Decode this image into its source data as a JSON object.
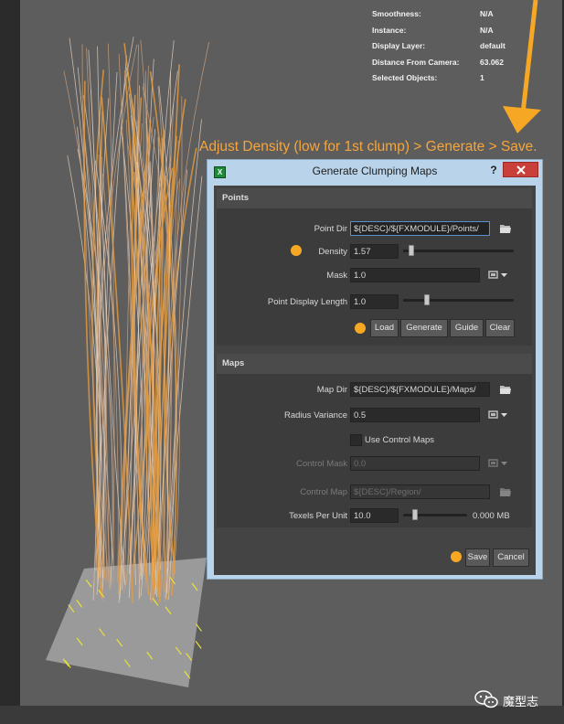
{
  "hud": {
    "rows": [
      {
        "label": "Smoothness:",
        "value": "N/A"
      },
      {
        "label": "Instance:",
        "value": "N/A"
      },
      {
        "label": "Display Layer:",
        "value": "default"
      },
      {
        "label": "Distance From Camera:",
        "value": "63.062"
      },
      {
        "label": "Selected Objects:",
        "value": "1"
      }
    ]
  },
  "instruction": "Adjust Density (low for 1st clump) > Generate > Save.",
  "dialog": {
    "title": "Generate Clumping Maps",
    "help": "?",
    "icon_letter": "X",
    "points": {
      "title": "Points",
      "point_dir_label": "Point Dir",
      "point_dir_value": "${DESC}/${FXMODULE}/Points/",
      "density_label": "Density",
      "density_value": "1.57",
      "density_slider_fraction": 0.05,
      "mask_label": "Mask",
      "mask_value": "1.0",
      "display_length_label": "Point Display Length",
      "display_length_value": "1.0",
      "display_length_slider_fraction": 0.2,
      "buttons": {
        "load": "Load",
        "generate": "Generate",
        "guide": "Guide",
        "clear": "Clear"
      }
    },
    "maps": {
      "title": "Maps",
      "map_dir_label": "Map Dir",
      "map_dir_value": "${DESC}/${FXMODULE}/Maps/",
      "radius_label": "Radius Variance",
      "radius_value": "0.5",
      "use_control_label": "Use Control Maps",
      "use_control_checked": false,
      "control_mask_label": "Control Mask",
      "control_mask_value": "0.0",
      "control_map_label": "Control Map",
      "control_map_value": "${DESC}/Region/",
      "texels_label": "Texels Per Unit",
      "texels_value": "10.0",
      "texels_slider_fraction": 0.15,
      "size_readout": "0.000 MB"
    },
    "save_label": "Save",
    "cancel_label": "Cancel"
  },
  "watermark": "魔型志",
  "colors": {
    "accent": "#f6a825",
    "instruction": "#f7a53a",
    "close": "#c9403a",
    "frame": "#b9d3ea"
  }
}
